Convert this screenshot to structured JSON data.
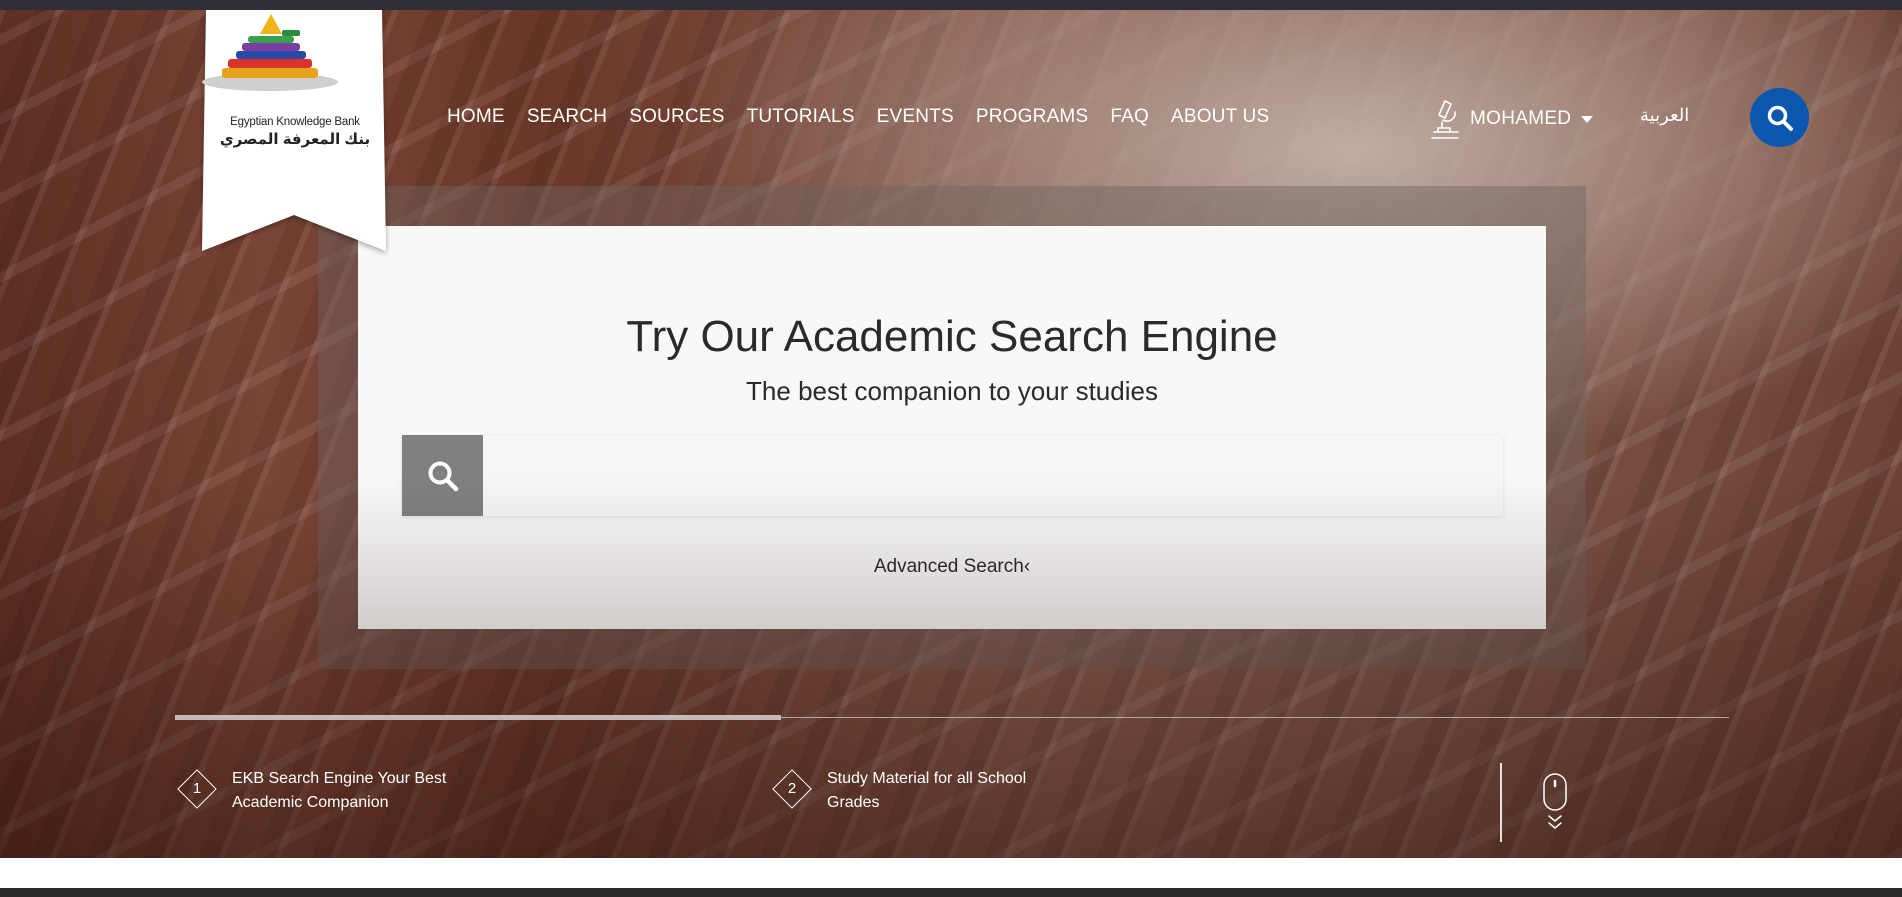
{
  "brand": {
    "name_en": "Egyptian Knowledge Bank",
    "name_ar": "بنك المعرفة المصري"
  },
  "nav": {
    "items": [
      {
        "label": "HOME"
      },
      {
        "label": "SEARCH"
      },
      {
        "label": "SOURCES"
      },
      {
        "label": "TUTORIALS"
      },
      {
        "label": "EVENTS"
      },
      {
        "label": "PROGRAMS"
      },
      {
        "label": "FAQ"
      },
      {
        "label": "ABOUT US"
      }
    ]
  },
  "user": {
    "name": "MOHAMED",
    "icon": "microscope-icon"
  },
  "language_toggle": "العربية",
  "hero": {
    "title": "Try Our Academic Search Engine",
    "subtitle": "The best companion to your studies",
    "search": {
      "value": "",
      "placeholder": "",
      "icon": "search-icon"
    },
    "advanced_search": "Advanced Search‹"
  },
  "slider": {
    "progress": 0.39,
    "slides": [
      {
        "number": "1",
        "text": "EKB Search Engine Your Best Academic Companion"
      },
      {
        "number": "2",
        "text": "Study Material for all School Grades"
      }
    ]
  },
  "colors": {
    "accent_blue": "#0b57b0",
    "search_button_gray": "#808080",
    "card_background": "#f8f8f8",
    "nav_text": "#ffffff"
  }
}
